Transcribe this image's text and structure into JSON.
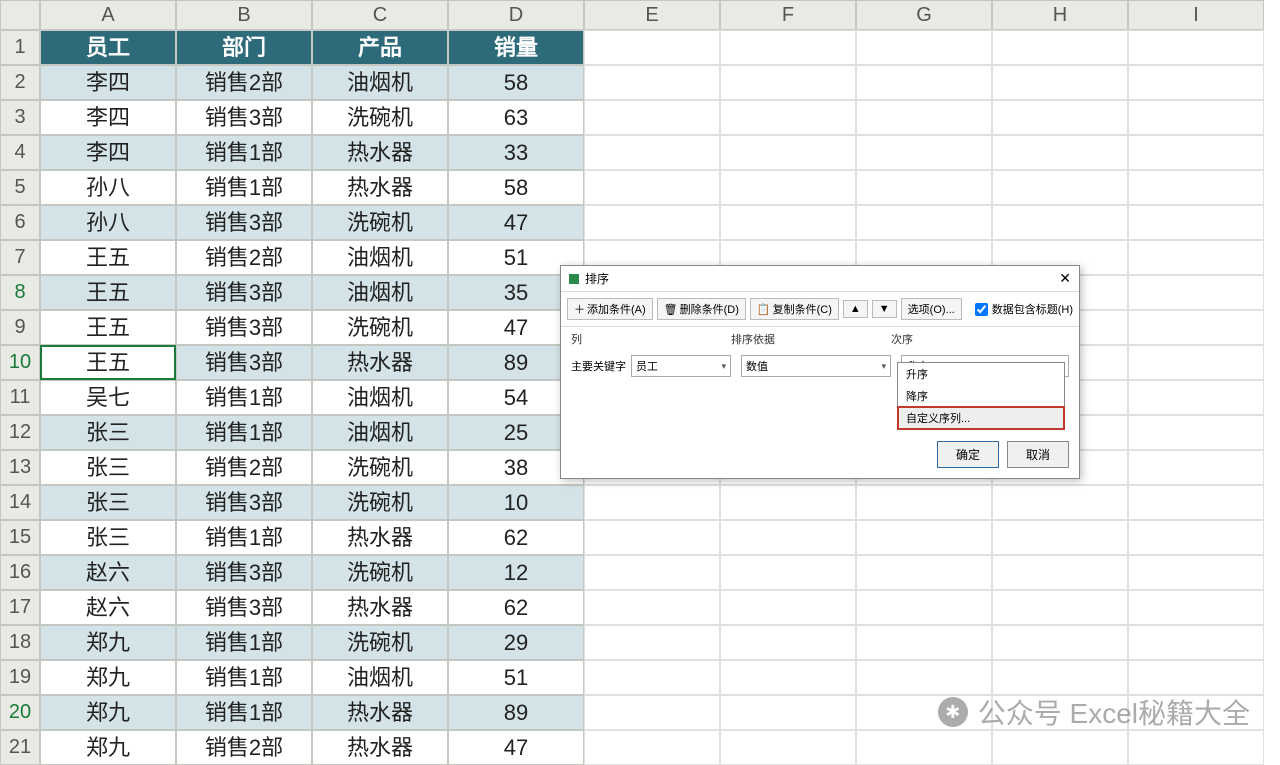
{
  "columns": [
    "A",
    "B",
    "C",
    "D",
    "E",
    "F",
    "G",
    "H",
    "I"
  ],
  "rows": [
    "1",
    "2",
    "3",
    "4",
    "5",
    "6",
    "7",
    "8",
    "9",
    "10",
    "11",
    "12",
    "13",
    "14",
    "15",
    "16",
    "17",
    "18",
    "19",
    "20",
    "21"
  ],
  "headers": [
    "员工",
    "部门",
    "产品",
    "销量"
  ],
  "data": [
    [
      "李四",
      "销售2部",
      "油烟机",
      "58"
    ],
    [
      "李四",
      "销售3部",
      "洗碗机",
      "63"
    ],
    [
      "李四",
      "销售1部",
      "热水器",
      "33"
    ],
    [
      "孙八",
      "销售1部",
      "热水器",
      "58"
    ],
    [
      "孙八",
      "销售3部",
      "洗碗机",
      "47"
    ],
    [
      "王五",
      "销售2部",
      "油烟机",
      "51"
    ],
    [
      "王五",
      "销售3部",
      "油烟机",
      "35"
    ],
    [
      "王五",
      "销售3部",
      "洗碗机",
      "47"
    ],
    [
      "王五",
      "销售3部",
      "热水器",
      "89"
    ],
    [
      "吴七",
      "销售1部",
      "油烟机",
      "54"
    ],
    [
      "张三",
      "销售1部",
      "油烟机",
      "25"
    ],
    [
      "张三",
      "销售2部",
      "洗碗机",
      "38"
    ],
    [
      "张三",
      "销售3部",
      "洗碗机",
      "10"
    ],
    [
      "张三",
      "销售1部",
      "热水器",
      "62"
    ],
    [
      "赵六",
      "销售3部",
      "洗碗机",
      "12"
    ],
    [
      "赵六",
      "销售3部",
      "热水器",
      "62"
    ],
    [
      "郑九",
      "销售1部",
      "洗碗机",
      "29"
    ],
    [
      "郑九",
      "销售1部",
      "油烟机",
      "51"
    ],
    [
      "郑九",
      "销售1部",
      "热水器",
      "89"
    ],
    [
      "郑九",
      "销售2部",
      "热水器",
      "47"
    ]
  ],
  "selected_row": 10,
  "hl_rows": [
    8,
    10,
    20
  ],
  "dialog": {
    "title": "排序",
    "add": "添加条件(A)",
    "del": "删除条件(D)",
    "copy": "复制条件(C)",
    "opts": "选项(O)...",
    "has_header": "数据包含标题(H)",
    "col_labels": [
      "列",
      "排序依据",
      "次序"
    ],
    "key_label": "主要关键字",
    "key_value": "员工",
    "basis_value": "数值",
    "order_value": "升序",
    "dropdown": [
      "升序",
      "降序",
      "自定义序列..."
    ],
    "ok": "确定",
    "cancel": "取消"
  },
  "watermark": "公众号   Excel秘籍大全"
}
